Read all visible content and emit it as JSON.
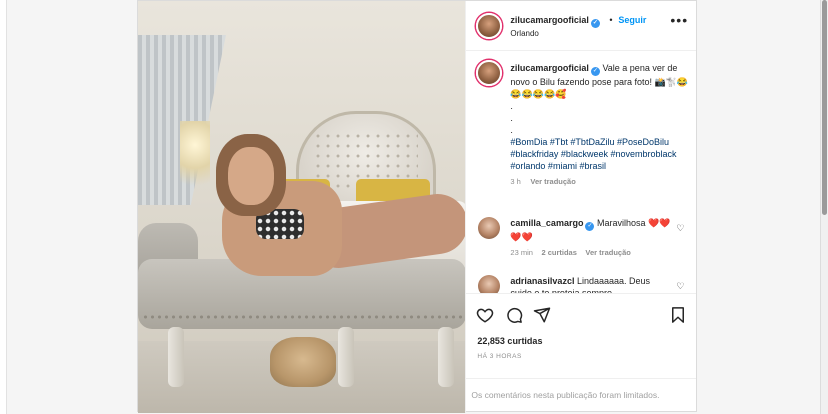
{
  "header": {
    "username": "zilucamargooficial",
    "follow_label": "Seguir",
    "separator": "•",
    "location": "Orlando",
    "more_glyph": "•••"
  },
  "caption": {
    "username": "zilucamargooficial",
    "text": "Vale a pena ver de novo o Bilu fazendo pose para foto! 📸🐩😂😂😂😂😂🥰",
    "dots": [
      ".",
      ".",
      "."
    ],
    "hashtags": "#BomDia #Tbt #TbtDaZilu #PoseDoBilu #blackfriday #blackweek #novembroblack #orlando #miami #brasil",
    "time": "3 h",
    "translate": "Ver tradução"
  },
  "comments": [
    {
      "username": "camilla_camargo",
      "text": "Maravilhosa ❤️❤️❤️❤️",
      "time": "23 min",
      "likes": "2 curtidas",
      "translate": "Ver tradução"
    },
    {
      "username": "adrianasilvazcl",
      "text": "Lindaaaaaa. Deus cuide e te proteja sempre"
    }
  ],
  "actions": {
    "likes": "22,853 curtidas",
    "posted": "HÁ 3 HORAS"
  },
  "footer": {
    "notice": "Os comentários nesta publicação foram limitados."
  },
  "colors": {
    "link_blue": "#0095f6",
    "hashtag_blue": "#00376b",
    "verified_blue": "#3897f0",
    "muted": "#8e8e8e"
  },
  "icons": [
    "verified-badge-icon",
    "more-options-icon",
    "heart-icon",
    "comment-icon",
    "share-icon",
    "bookmark-icon"
  ]
}
